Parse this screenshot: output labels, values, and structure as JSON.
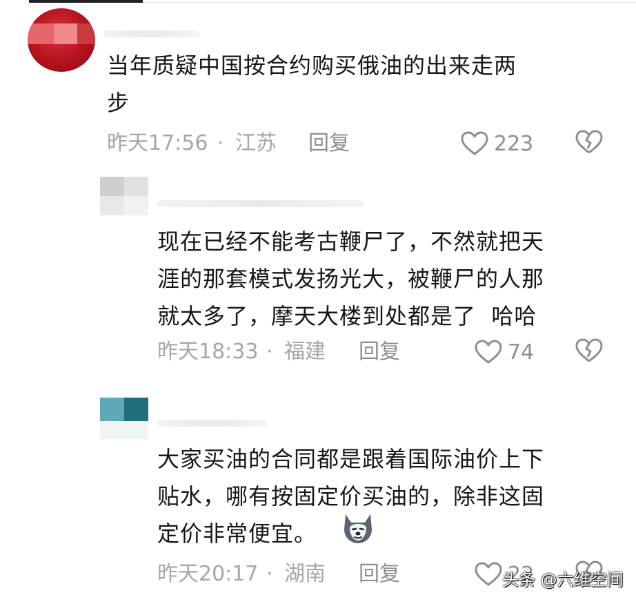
{
  "comments": [
    {
      "text": "当年质疑中国按合约购买俄油的出来走两\n步",
      "time": "昨天17:56",
      "separator": "·",
      "location": "江苏",
      "reply_label": "回复",
      "likes": "223"
    },
    {
      "text": "现在已经不能考古鞭尸了，不然就把天\n涯的那套模式发扬光大，被鞭尸的人那\n就太多了，摩天大楼到处都是了  哈哈",
      "time": "昨天18:33",
      "separator": "·",
      "location": "福建",
      "reply_label": "回复",
      "likes": "74"
    },
    {
      "text": "大家买油的合同都是跟着国际油价上下\n贴水，哪有按固定价买油的，除非这固\n定价非常便宜。",
      "time": "昨天20:17",
      "separator": "·",
      "location": "湖南",
      "reply_label": "回复",
      "likes": "22"
    }
  ],
  "watermark": "头条 @六维空间",
  "colors": {
    "text": "#161616",
    "meta": "#a6a6a6",
    "action": "#8e8e8e"
  }
}
